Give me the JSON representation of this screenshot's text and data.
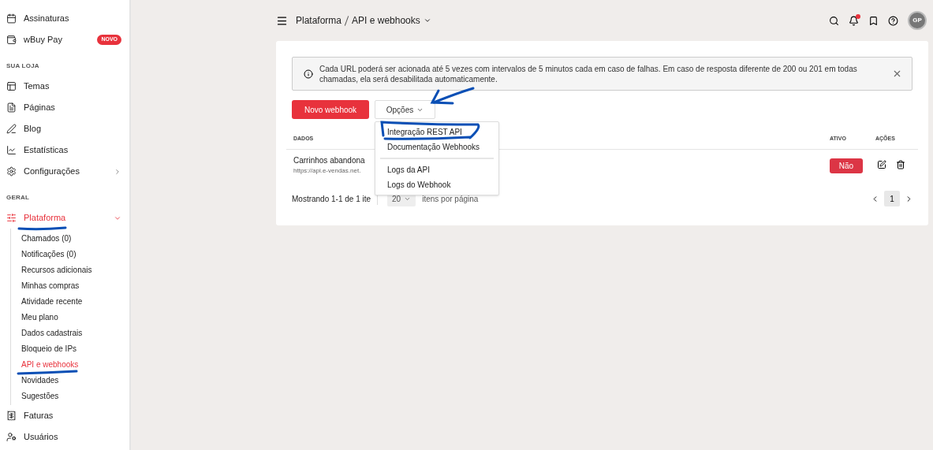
{
  "sidebar": {
    "sections": [
      {
        "items": [
          {
            "label": "Assinaturas",
            "selected": false
          },
          {
            "label": "wBuy Pay",
            "badge": "NOVO",
            "selected": false
          }
        ]
      },
      {
        "heading": "SUA LOJA",
        "items": [
          {
            "label": "Temas",
            "selected": false
          },
          {
            "label": "Páginas",
            "selected": false
          },
          {
            "label": "Blog",
            "selected": false
          },
          {
            "label": "Estatísticas",
            "selected": false
          },
          {
            "label": "Configurações",
            "selected": false,
            "expanded": false
          }
        ]
      },
      {
        "heading": "GERAL",
        "items": [
          {
            "label": "Plataforma",
            "selected": true,
            "expanded": true,
            "children": [
              {
                "label": "Chamados (0)",
                "selected": false
              },
              {
                "label": "Notificações (0)",
                "selected": false
              },
              {
                "label": "Recursos adicionais",
                "selected": false
              },
              {
                "label": "Minhas compras",
                "selected": false
              },
              {
                "label": "Atividade recente",
                "selected": false
              },
              {
                "label": "Meu plano",
                "selected": false
              },
              {
                "label": "Dados cadastrais",
                "selected": false
              },
              {
                "label": "Bloqueio de IPs",
                "selected": false
              },
              {
                "label": "API e webhooks",
                "selected": true
              },
              {
                "label": "Novidades",
                "selected": false
              },
              {
                "label": "Sugestões",
                "selected": false
              }
            ]
          },
          {
            "label": "Faturas",
            "selected": false
          },
          {
            "label": "Usuários",
            "selected": false
          }
        ]
      }
    ]
  },
  "breadcrumb": [
    "Plataforma",
    "API e webhooks"
  ],
  "header": {
    "avatar": "GP",
    "notification_dot": true
  },
  "alert": "Cada URL poderá ser acionada até 5 vezes com intervalos de 5 minutos cada em caso de falhas. Em caso de resposta diferente de 200 ou 201 em todas chamadas, ela será desabilitada automaticamente.",
  "buttons": {
    "primary": "Novo webhook",
    "options": "Opções"
  },
  "options_menu": {
    "groups": [
      [
        "Integração REST API",
        "Documentação Webhooks"
      ],
      [
        "Logs da API",
        "Logs do Webhook"
      ]
    ]
  },
  "table": {
    "columns": [
      "DADOS",
      "ATIVO",
      "AÇÕES"
    ],
    "rows": [
      {
        "name": "Carrinhos abandona",
        "url": "https://api.e-vendas.net.",
        "active": false,
        "active_label": "Não"
      }
    ]
  },
  "pagination": {
    "summary": "Mostrando 1-1 de 1 ite",
    "per_page": "20",
    "per_page_label": "itens por página",
    "pages": [
      {
        "label": "1",
        "selected": true
      }
    ]
  }
}
